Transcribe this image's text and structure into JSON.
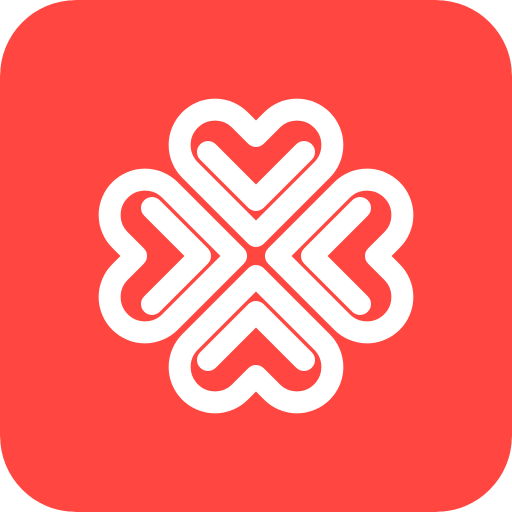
{
  "icon": {
    "name": "four-heart-clover-logo-icon",
    "background_color": "#FF4640",
    "foreground_color": "#FFFFFF"
  }
}
